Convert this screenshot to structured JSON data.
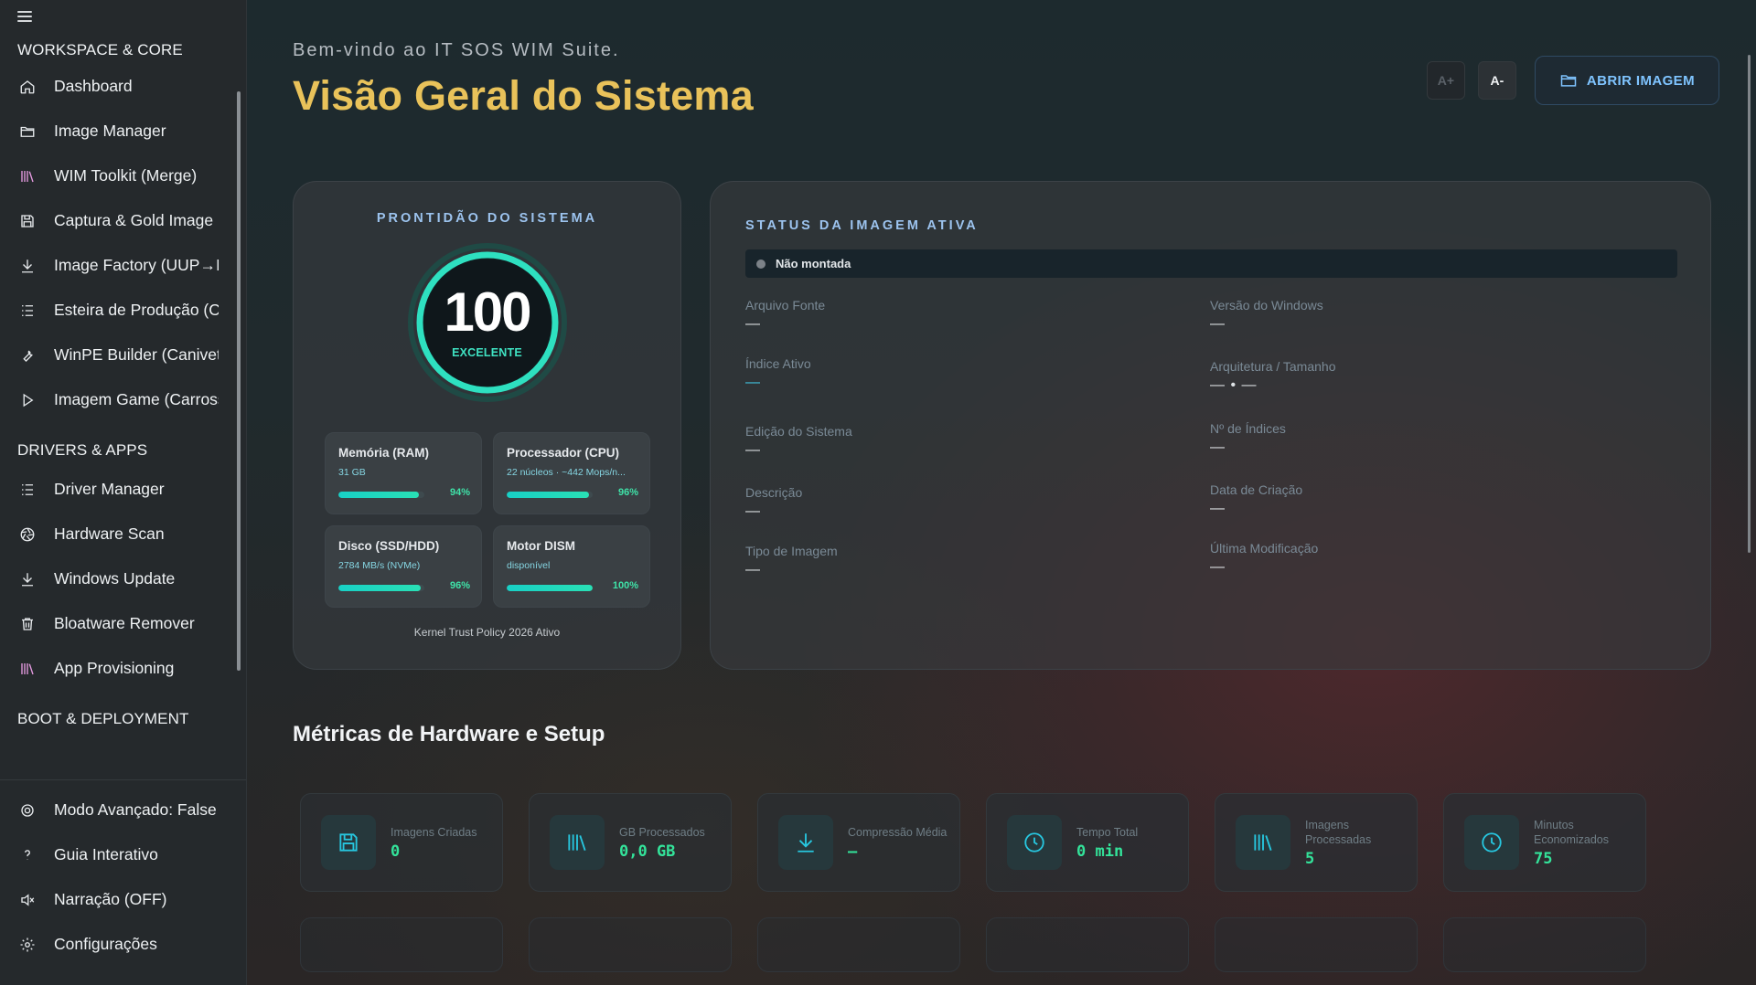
{
  "sidebar": {
    "sections": [
      {
        "title": "WORKSPACE & CORE",
        "items": [
          {
            "label": "Dashboard",
            "icon": "home-icon"
          },
          {
            "label": "Image Manager",
            "icon": "folder-icon"
          },
          {
            "label": "WIM Toolkit (Merge)",
            "icon": "library-icon"
          },
          {
            "label": "Captura & Gold Image",
            "icon": "save-icon"
          },
          {
            "label": "Image Factory (UUP→ISO)",
            "icon": "download-icon"
          },
          {
            "label": "Esteira de Produção (Ca",
            "icon": "list-icon"
          },
          {
            "label": "WinPE Builder (Canivete",
            "icon": "wrench-icon"
          },
          {
            "label": "Imagem Game (Carross",
            "icon": "play-icon"
          }
        ]
      },
      {
        "title": "DRIVERS & APPS",
        "items": [
          {
            "label": "Driver Manager",
            "icon": "list-icon"
          },
          {
            "label": "Hardware Scan",
            "icon": "aperture-icon"
          },
          {
            "label": "Windows Update",
            "icon": "download-icon"
          },
          {
            "label": "Bloatware Remover",
            "icon": "trash-icon"
          },
          {
            "label": "App Provisioning",
            "icon": "library-icon"
          }
        ]
      },
      {
        "title": "BOOT & DEPLOYMENT",
        "items": []
      }
    ],
    "bottom": [
      {
        "label": "Modo Avançado: False",
        "icon": "target-icon"
      },
      {
        "label": "Guia Interativo",
        "icon": "question-icon"
      },
      {
        "label": "Narração (OFF)",
        "icon": "speaker-off-icon"
      },
      {
        "label": "Configurações",
        "icon": "gear-icon"
      }
    ]
  },
  "header": {
    "welcome": "Bem-vindo ao IT SOS WIM Suite.",
    "title": "Visão Geral do Sistema",
    "font_increase": "A+",
    "font_decrease": "A-",
    "open_image": "ABRIR IMAGEM"
  },
  "readiness": {
    "title": "PRONTIDÃO DO SISTEMA",
    "score": "100",
    "score_fraction": 1.0,
    "rating": "EXCELENTE",
    "metrics": [
      {
        "name": "Memória (RAM)",
        "sub": "31 GB",
        "percent": 94,
        "percent_label": "94%"
      },
      {
        "name": "Processador (CPU)",
        "sub": "22 núcleos · ~442 Mops/n...",
        "percent": 96,
        "percent_label": "96%"
      },
      {
        "name": "Disco (SSD/HDD)",
        "sub": "2784 MB/s (NVMe)",
        "percent": 96,
        "percent_label": "96%"
      },
      {
        "name": "Motor DISM",
        "sub": "disponível",
        "percent": 100,
        "percent_label": "100%"
      }
    ],
    "footer": "Kernel Trust Policy 2026 Ativo"
  },
  "image_status": {
    "title": "STATUS DA IMAGEM ATIVA",
    "mount_state": "Não montada",
    "left_fields": [
      {
        "label": "Arquivo Fonte",
        "value": "—"
      },
      {
        "label": "Índice Ativo",
        "value": "—"
      },
      {
        "label": "Edição do Sistema",
        "value": "—"
      },
      {
        "label": "Descrição",
        "value": "—"
      },
      {
        "label": "Tipo de Imagem",
        "value": "—"
      }
    ],
    "right_fields": [
      {
        "label": "Versão do Windows",
        "value": "—"
      },
      {
        "label": "Arquitetura / Tamanho",
        "value": "— • —"
      },
      {
        "label": "Nº de Índices",
        "value": "—"
      },
      {
        "label": "Data de Criação",
        "value": "—"
      },
      {
        "label": "Última Modificação",
        "value": "—"
      }
    ]
  },
  "hardware": {
    "title": "Métricas de Hardware e Setup",
    "stats": [
      {
        "label": "Imagens Criadas",
        "value": "0",
        "icon": "save-icon"
      },
      {
        "label": "GB Processados",
        "value": "0,0 GB",
        "icon": "library-icon"
      },
      {
        "label": "Compressão Média",
        "value": "—",
        "icon": "download-icon"
      },
      {
        "label": "Tempo Total",
        "value": "0 min",
        "icon": "clock-icon"
      },
      {
        "label": "Imagens Processadas",
        "value": "5",
        "icon": "library-icon"
      },
      {
        "label": "Minutos Economizados",
        "value": "75",
        "icon": "clock-icon"
      }
    ]
  },
  "colors": {
    "accent_gold": "#e9c25a",
    "accent_teal": "#2ee0c0",
    "accent_blue": "#7fc4ff",
    "value_green": "#33e39a"
  }
}
